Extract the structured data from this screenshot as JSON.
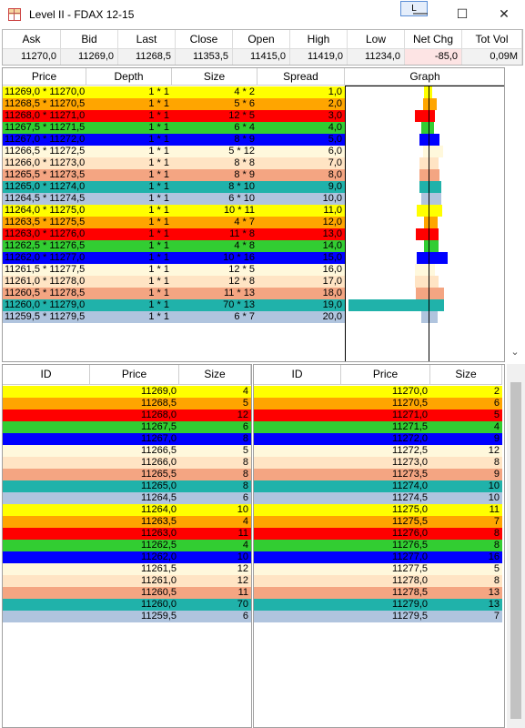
{
  "window": {
    "title": "Level II - FDAX 12-15",
    "l_button": "L",
    "minimize": "—",
    "maximize": "☐",
    "close": "✕"
  },
  "quote": {
    "headers": [
      "Ask",
      "Bid",
      "Last",
      "Close",
      "Open",
      "High",
      "Low",
      "Net Chg",
      "Tot Vol"
    ],
    "values": [
      "11270,0",
      "11269,0",
      "11268,5",
      "11353,5",
      "11415,0",
      "11419,0",
      "11234,0",
      "-85,0",
      "0,09M"
    ]
  },
  "upper_table": {
    "headers": [
      "Price",
      "Depth",
      "Size",
      "Spread",
      "Graph"
    ],
    "rows": [
      {
        "price": "11269,0 * 11270,0",
        "depth": "1 * 1",
        "size": "4 * 2",
        "spread": "1,0",
        "bg": "#ffff00",
        "fg": "#000000",
        "bid": 4,
        "ask": 2,
        "bid_color": "#ffff00",
        "ask_color": "#ffff00"
      },
      {
        "price": "11268,5 * 11270,5",
        "depth": "1 * 1",
        "size": "5 * 6",
        "spread": "2,0",
        "bg": "#ffa500",
        "fg": "#000000",
        "bid": 5,
        "ask": 6,
        "bid_color": "#ffa500",
        "ask_color": "#ffa500"
      },
      {
        "price": "11268,0 * 11271,0",
        "depth": "1 * 1",
        "size": "12 * 5",
        "spread": "3,0",
        "bg": "#ff0000",
        "fg": "#000000",
        "bid": 12,
        "ask": 5,
        "bid_color": "#ff0000",
        "ask_color": "#ff0000"
      },
      {
        "price": "11267,5 * 11271,5",
        "depth": "1 * 1",
        "size": "6 * 4",
        "spread": "4,0",
        "bg": "#32cd32",
        "fg": "#000000",
        "bid": 6,
        "ask": 4,
        "bid_color": "#32cd32",
        "ask_color": "#32cd32"
      },
      {
        "price": "11267,0 * 11272,0",
        "depth": "1 * 1",
        "size": "8 * 9",
        "spread": "5,0",
        "bg": "#0000ff",
        "fg": "#000000",
        "bid": 8,
        "ask": 9,
        "bid_color": "#0000ff",
        "ask_color": "#0000ff"
      },
      {
        "price": "11266,5 * 11272,5",
        "depth": "1 * 1",
        "size": "5 * 12",
        "spread": "6,0",
        "bg": "#fff8dc",
        "fg": "#000000",
        "bid": 5,
        "ask": 12,
        "bid_color": "#fff8dc",
        "ask_color": "#fff8dc"
      },
      {
        "price": "11266,0 * 11273,0",
        "depth": "1 * 1",
        "size": "8 * 8",
        "spread": "7,0",
        "bg": "#ffe4c4",
        "fg": "#000000",
        "bid": 8,
        "ask": 8,
        "bid_color": "#ffe4c4",
        "ask_color": "#ffe4c4"
      },
      {
        "price": "11265,5 * 11273,5",
        "depth": "1 * 1",
        "size": "8 * 9",
        "spread": "8,0",
        "bg": "#f4a582",
        "fg": "#000000",
        "bid": 8,
        "ask": 9,
        "bid_color": "#f4a582",
        "ask_color": "#f4a582"
      },
      {
        "price": "11265,0 * 11274,0",
        "depth": "1 * 1",
        "size": "8 * 10",
        "spread": "9,0",
        "bg": "#20b2aa",
        "fg": "#000000",
        "bid": 8,
        "ask": 10,
        "bid_color": "#20b2aa",
        "ask_color": "#20b2aa"
      },
      {
        "price": "11264,5 * 11274,5",
        "depth": "1 * 1",
        "size": "6 * 10",
        "spread": "10,0",
        "bg": "#b0c4de",
        "fg": "#000000",
        "bid": 6,
        "ask": 10,
        "bid_color": "#b0c4de",
        "ask_color": "#b0c4de"
      },
      {
        "price": "11264,0 * 11275,0",
        "depth": "1 * 1",
        "size": "10 * 11",
        "spread": "11,0",
        "bg": "#ffff00",
        "fg": "#000000",
        "bid": 10,
        "ask": 11,
        "bid_color": "#ffff00",
        "ask_color": "#ffff00"
      },
      {
        "price": "11263,5 * 11275,5",
        "depth": "1 * 1",
        "size": "4 * 7",
        "spread": "12,0",
        "bg": "#ffa500",
        "fg": "#000000",
        "bid": 4,
        "ask": 7,
        "bid_color": "#ffa500",
        "ask_color": "#ffa500"
      },
      {
        "price": "11263,0 * 11276,0",
        "depth": "1 * 1",
        "size": "11 * 8",
        "spread": "13,0",
        "bg": "#ff0000",
        "fg": "#000000",
        "bid": 11,
        "ask": 8,
        "bid_color": "#ff0000",
        "ask_color": "#ff0000"
      },
      {
        "price": "11262,5 * 11276,5",
        "depth": "1 * 1",
        "size": "4 * 8",
        "spread": "14,0",
        "bg": "#32cd32",
        "fg": "#000000",
        "bid": 4,
        "ask": 8,
        "bid_color": "#32cd32",
        "ask_color": "#32cd32"
      },
      {
        "price": "11262,0 * 11277,0",
        "depth": "1 * 1",
        "size": "10 * 16",
        "spread": "15,0",
        "bg": "#0000ff",
        "fg": "#000000",
        "bid": 10,
        "ask": 16,
        "bid_color": "#0000ff",
        "ask_color": "#0000ff"
      },
      {
        "price": "11261,5 * 11277,5",
        "depth": "1 * 1",
        "size": "12 * 5",
        "spread": "16,0",
        "bg": "#fff8dc",
        "fg": "#000000",
        "bid": 12,
        "ask": 5,
        "bid_color": "#fff8dc",
        "ask_color": "#fff8dc"
      },
      {
        "price": "11261,0 * 11278,0",
        "depth": "1 * 1",
        "size": "12 * 8",
        "spread": "17,0",
        "bg": "#ffe4c4",
        "fg": "#000000",
        "bid": 12,
        "ask": 8,
        "bid_color": "#ffe4c4",
        "ask_color": "#ffe4c4"
      },
      {
        "price": "11260,5 * 11278,5",
        "depth": "1 * 1",
        "size": "11 * 13",
        "spread": "18,0",
        "bg": "#f4a582",
        "fg": "#000000",
        "bid": 11,
        "ask": 13,
        "bid_color": "#f4a582",
        "ask_color": "#f4a582"
      },
      {
        "price": "11260,0 * 11279,0",
        "depth": "1 * 1",
        "size": "70 * 13",
        "spread": "19,0",
        "bg": "#20b2aa",
        "fg": "#000000",
        "bid": 70,
        "ask": 13,
        "bid_color": "#20b2aa",
        "ask_color": "#20b2aa"
      },
      {
        "price": "11259,5 * 11279,5",
        "depth": "1 * 1",
        "size": "6 * 7",
        "spread": "20,0",
        "bg": "#b0c4de",
        "fg": "#000000",
        "bid": 6,
        "ask": 7,
        "bid_color": "#b0c4de",
        "ask_color": "#b0c4de"
      }
    ]
  },
  "bid_table": {
    "headers": [
      "ID",
      "Price",
      "Size"
    ],
    "rows": [
      {
        "id": "",
        "price": "11269,0",
        "size": "4",
        "bg": "#ffff00"
      },
      {
        "id": "",
        "price": "11268,5",
        "size": "5",
        "bg": "#ffa500"
      },
      {
        "id": "",
        "price": "11268,0",
        "size": "12",
        "bg": "#ff0000"
      },
      {
        "id": "",
        "price": "11267,5",
        "size": "6",
        "bg": "#32cd32"
      },
      {
        "id": "",
        "price": "11267,0",
        "size": "8",
        "bg": "#0000ff"
      },
      {
        "id": "",
        "price": "11266,5",
        "size": "5",
        "bg": "#fff8dc"
      },
      {
        "id": "",
        "price": "11266,0",
        "size": "8",
        "bg": "#ffe4c4"
      },
      {
        "id": "",
        "price": "11265,5",
        "size": "8",
        "bg": "#f4a582"
      },
      {
        "id": "",
        "price": "11265,0",
        "size": "8",
        "bg": "#20b2aa"
      },
      {
        "id": "",
        "price": "11264,5",
        "size": "6",
        "bg": "#b0c4de"
      },
      {
        "id": "",
        "price": "11264,0",
        "size": "10",
        "bg": "#ffff00"
      },
      {
        "id": "",
        "price": "11263,5",
        "size": "4",
        "bg": "#ffa500"
      },
      {
        "id": "",
        "price": "11263,0",
        "size": "11",
        "bg": "#ff0000"
      },
      {
        "id": "",
        "price": "11262,5",
        "size": "4",
        "bg": "#32cd32"
      },
      {
        "id": "",
        "price": "11262,0",
        "size": "10",
        "bg": "#0000ff"
      },
      {
        "id": "",
        "price": "11261,5",
        "size": "12",
        "bg": "#fff8dc"
      },
      {
        "id": "",
        "price": "11261,0",
        "size": "12",
        "bg": "#ffe4c4"
      },
      {
        "id": "",
        "price": "11260,5",
        "size": "11",
        "bg": "#f4a582"
      },
      {
        "id": "",
        "price": "11260,0",
        "size": "70",
        "bg": "#20b2aa"
      },
      {
        "id": "",
        "price": "11259,5",
        "size": "6",
        "bg": "#b0c4de"
      }
    ]
  },
  "ask_table": {
    "headers": [
      "ID",
      "Price",
      "Size"
    ],
    "rows": [
      {
        "id": "",
        "price": "11270,0",
        "size": "2",
        "bg": "#ffff00"
      },
      {
        "id": "",
        "price": "11270,5",
        "size": "6",
        "bg": "#ffa500"
      },
      {
        "id": "",
        "price": "11271,0",
        "size": "5",
        "bg": "#ff0000"
      },
      {
        "id": "",
        "price": "11271,5",
        "size": "4",
        "bg": "#32cd32"
      },
      {
        "id": "",
        "price": "11272,0",
        "size": "9",
        "bg": "#0000ff"
      },
      {
        "id": "",
        "price": "11272,5",
        "size": "12",
        "bg": "#fff8dc"
      },
      {
        "id": "",
        "price": "11273,0",
        "size": "8",
        "bg": "#ffe4c4"
      },
      {
        "id": "",
        "price": "11273,5",
        "size": "9",
        "bg": "#f4a582"
      },
      {
        "id": "",
        "price": "11274,0",
        "size": "10",
        "bg": "#20b2aa"
      },
      {
        "id": "",
        "price": "11274,5",
        "size": "10",
        "bg": "#b0c4de"
      },
      {
        "id": "",
        "price": "11275,0",
        "size": "11",
        "bg": "#ffff00"
      },
      {
        "id": "",
        "price": "11275,5",
        "size": "7",
        "bg": "#ffa500"
      },
      {
        "id": "",
        "price": "11276,0",
        "size": "8",
        "bg": "#ff0000"
      },
      {
        "id": "",
        "price": "11276,5",
        "size": "8",
        "bg": "#32cd32"
      },
      {
        "id": "",
        "price": "11277,0",
        "size": "16",
        "bg": "#0000ff"
      },
      {
        "id": "",
        "price": "11277,5",
        "size": "5",
        "bg": "#fff8dc"
      },
      {
        "id": "",
        "price": "11278,0",
        "size": "8",
        "bg": "#ffe4c4"
      },
      {
        "id": "",
        "price": "11278,5",
        "size": "13",
        "bg": "#f4a582"
      },
      {
        "id": "",
        "price": "11279,0",
        "size": "13",
        "bg": "#20b2aa"
      },
      {
        "id": "",
        "price": "11279,5",
        "size": "7",
        "bg": "#b0c4de"
      }
    ]
  },
  "icons": {
    "app": "table-grid-icon",
    "scroll_down": "scroll-down-arrow-icon"
  }
}
